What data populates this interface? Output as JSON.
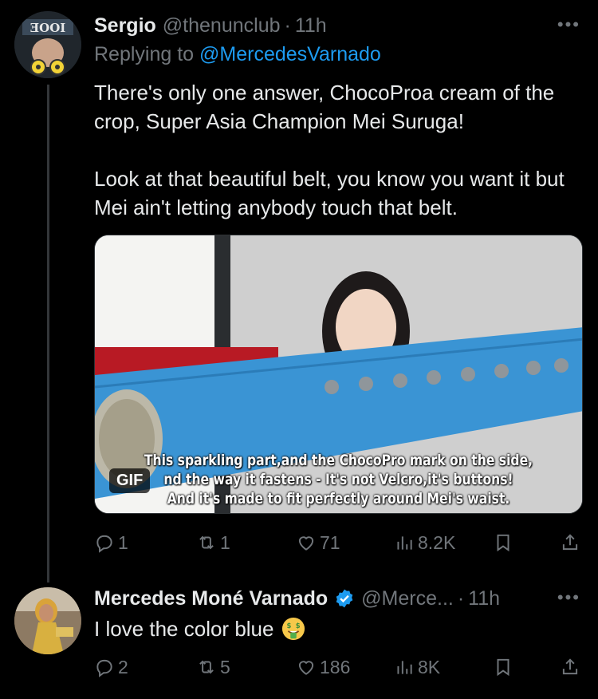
{
  "tweet1": {
    "name": "Sergio",
    "handle": "@thenunclub",
    "separator": "·",
    "time": "11h",
    "replying_prefix": "Replying to ",
    "replying_to": "@MercedesVarnado",
    "paragraph1": "There's only one answer, ChocoProa cream of the crop, Super Asia Champion Mei Suruga!",
    "paragraph2": "Look at that beautiful belt, you know you want it but Mei ain't letting anybody touch that belt.",
    "media": {
      "caption_line1": "This sparkling part,and the ChocoPro mark on the side,",
      "caption_line2": "nd the way it fastens - It's not Velcro,it's buttons!",
      "caption_line3": "And it's made to fit perfectly around Mei's waist.",
      "badge": "GIF"
    },
    "actions": {
      "replies": "1",
      "reposts": "1",
      "likes": "71",
      "views": "8.2K"
    },
    "more_icon": "ellipsis-icon"
  },
  "tweet2": {
    "name": "Mercedes Moné Varnado",
    "handle": "@Merce...",
    "separator": "·",
    "time": "11h",
    "text": "I love the color blue",
    "emoji": "money-mouth-face-emoji",
    "actions": {
      "replies": "2",
      "reposts": "5",
      "likes": "186",
      "views": "8K"
    }
  },
  "colors": {
    "background": "#000000",
    "text": "#e7e9ea",
    "muted": "#71767b",
    "accent": "#1d9bf0",
    "belt": "#3a94d4"
  }
}
